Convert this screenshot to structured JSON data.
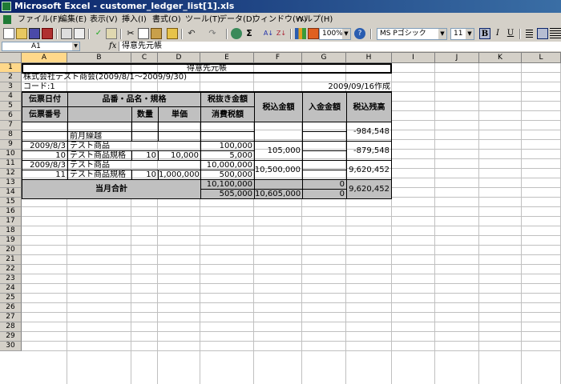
{
  "window": {
    "title": "Microsoft Excel - customer_ledger_list[1].xls"
  },
  "menu": [
    "ファイル(F)",
    "編集(E)",
    "表示(V)",
    "挿入(I)",
    "書式(O)",
    "ツール(T)",
    "データ(D)",
    "ウィンドウ(W)",
    "ヘルプ(H)"
  ],
  "toolbar": {
    "zoom": "100%",
    "font_name": "MS Pゴシック",
    "font_size": "11",
    "bold": "B",
    "italic": "I",
    "underline": "U",
    "sigma": "Σ"
  },
  "formula_bar": {
    "name_box": "A1",
    "fx": "fx",
    "content": "得意先元帳"
  },
  "columns": [
    "A",
    "B",
    "C",
    "D",
    "E",
    "F",
    "G",
    "H",
    "I",
    "J",
    "K",
    "L"
  ],
  "rows": [
    "1",
    "2",
    "3",
    "4",
    "5",
    "6",
    "7",
    "8",
    "9",
    "10",
    "11",
    "12",
    "13",
    "14",
    "15",
    "16",
    "17",
    "18",
    "19",
    "20",
    "21",
    "22",
    "23",
    "24",
    "25",
    "26",
    "27",
    "28",
    "29",
    "30"
  ],
  "sheet": {
    "title": "得意先元帳",
    "company": "株式会社テスト商会(2009/8/1～2009/9/30)",
    "code": "コード:1",
    "created": "2009/09/16作成",
    "headers": {
      "slip_date": "伝票日付",
      "item": "品番・品名・規格",
      "pretax": "税抜き金額",
      "tax_incl": "税込金額",
      "payment": "入金金額",
      "balance": "税込残高",
      "slip_no": "伝票番号",
      "qty": "数量",
      "unit_price": "単価",
      "tax": "消費税額"
    },
    "carry_label": "前月繰越",
    "carry_balance": "-984,548",
    "entries": [
      {
        "date": "2009/8/3",
        "product": "テスト商品",
        "amount": "100,000",
        "slip_no": "10",
        "spec": "テスト商品規格",
        "qty": "10",
        "unit_price": "10,000",
        "tax": "5,000",
        "tax_incl": "105,000",
        "balance": "-879,548"
      },
      {
        "date": "2009/8/3",
        "product": "テスト商品",
        "amount": "10,000,000",
        "slip_no": "11",
        "spec": "テスト商品規格",
        "qty": "10",
        "unit_price": "1,000,000",
        "tax": "500,000",
        "tax_incl": "10,500,000",
        "balance": "9,620,452"
      }
    ],
    "total": {
      "label": "当月合計",
      "pretax": "10,100,000",
      "tax": "505,000",
      "tax_incl": "10,605,000",
      "payment_1": "0",
      "payment_2": "0",
      "balance": "9,620,452"
    }
  }
}
